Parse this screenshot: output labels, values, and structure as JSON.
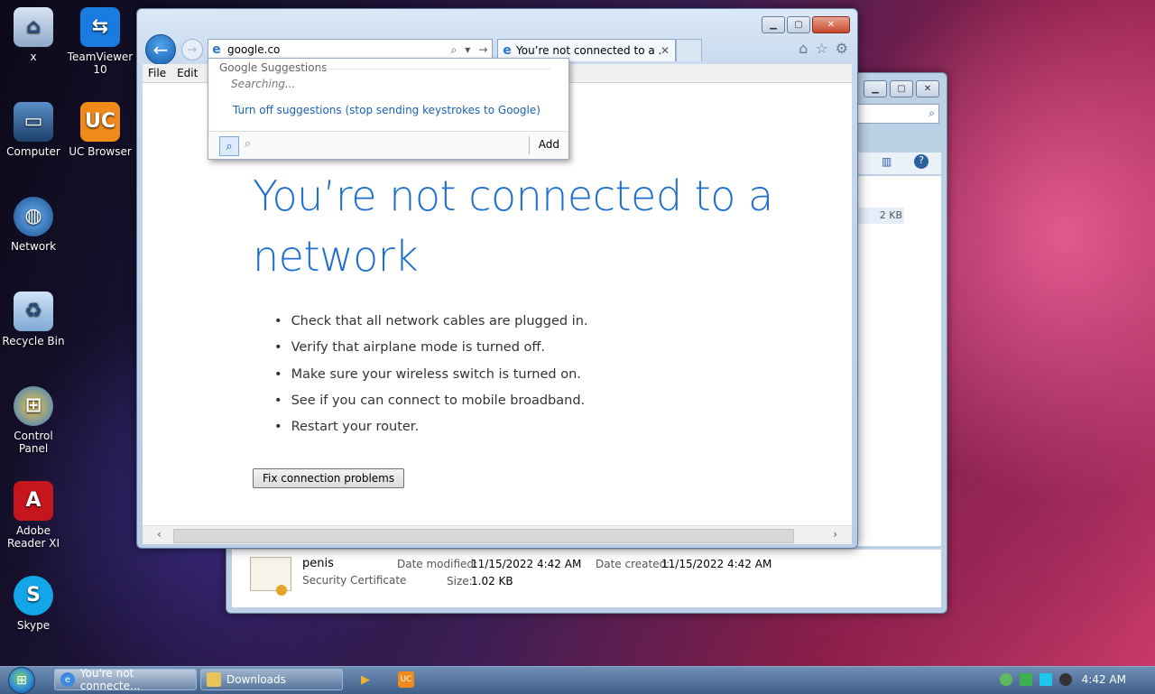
{
  "desktop": {
    "icons": [
      {
        "label": "x"
      },
      {
        "label": "TeamViewer 10"
      },
      {
        "label": "Computer"
      },
      {
        "label": "UC Browser"
      },
      {
        "label": "Network"
      },
      {
        "label": "Recycle Bin"
      },
      {
        "label": "Control Panel"
      },
      {
        "label": "Adobe Reader XI"
      },
      {
        "label": "Skype"
      }
    ]
  },
  "explorer": {
    "size_value": "2 KB",
    "file": {
      "name": "penis",
      "type": "Security Certificate",
      "date_modified_label": "Date modified:",
      "date_modified": "11/15/2022 4:42 AM",
      "date_created_label": "Date created:",
      "date_created": "11/15/2022 4:42 AM",
      "size_label": "Size:",
      "size": "1.02 KB"
    }
  },
  "browser": {
    "address_value": "google.co",
    "tab_title": "You’re not connected to a ...",
    "menu": [
      "File",
      "Edit"
    ],
    "suggestions": {
      "header": "Google Suggestions",
      "status": "Searching...",
      "turn_off": "Turn off suggestions (stop sending keystrokes to Google)",
      "add_label": "Add"
    },
    "page": {
      "headline": "You’re not connected to a network",
      "bullets": [
        "Check that all network cables are plugged in.",
        "Verify that airplane mode is turned off.",
        "Make sure your wireless switch is turned on.",
        "See if you can connect to mobile broadband.",
        "Restart your router."
      ],
      "fix_button": "Fix connection problems"
    }
  },
  "taskbar": {
    "items": [
      {
        "label": "You're not connecte..."
      },
      {
        "label": "Downloads"
      }
    ],
    "clock": "4:42 AM"
  }
}
